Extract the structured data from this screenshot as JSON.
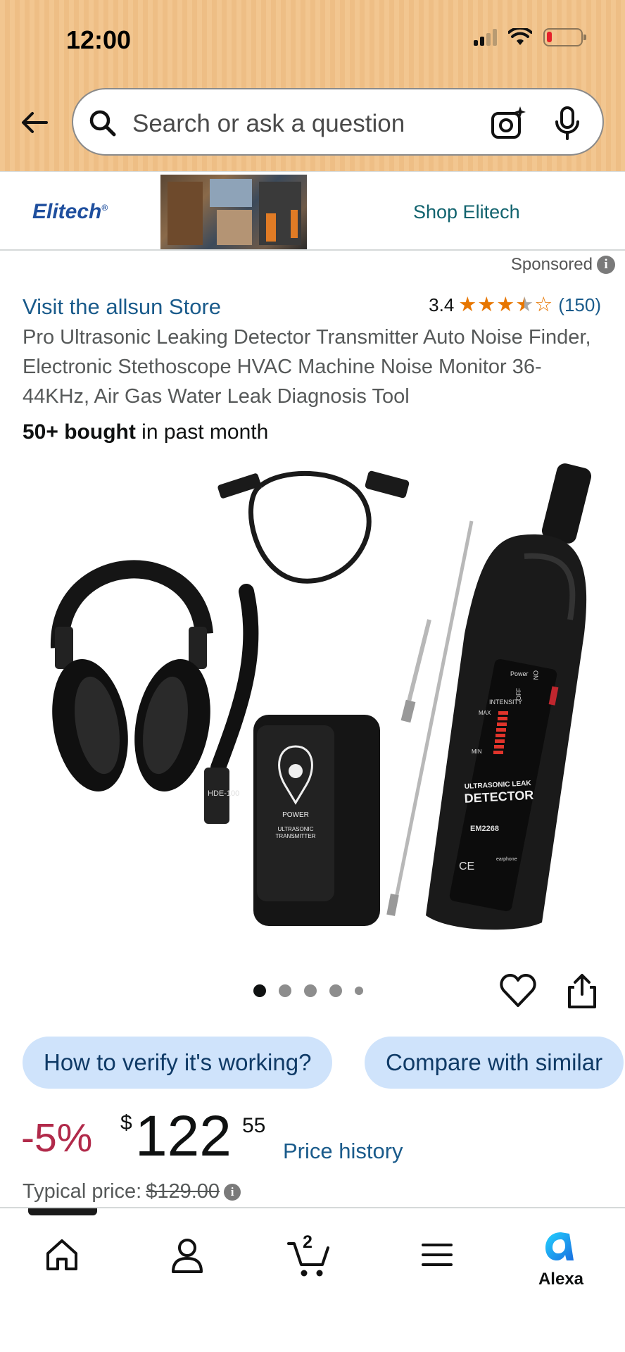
{
  "status_bar": {
    "time": "12:00"
  },
  "search": {
    "placeholder": "Search or ask a question"
  },
  "ad": {
    "brand": "Elitech",
    "brand_mark": "®",
    "link_text": "Shop Elitech",
    "sponsored_label": "Sponsored",
    "info_glyph": "i"
  },
  "product": {
    "store_link": "Visit the allsun Store",
    "rating_value": "3.4",
    "rating_stars": 3.5,
    "rating_count": "(150)",
    "title": "Pro Ultrasonic Leaking Detector Transmitter Auto Noise Finder, Electronic Stethoscope HVAC Machine Noise Monitor 36-44KHz, Air Gas Water Leak Diagnosis Tool",
    "bought_bold": "50+ bought",
    "bought_rest": " in past month",
    "image_labels": {
      "power": "Power",
      "on": "ON",
      "off": "OFF",
      "intensity": "INTENSITY",
      "max": "MAX",
      "min": "MIN",
      "detector_line1": "ULTRASONIC LEAK",
      "detector_line2": "DETECTOR",
      "model": "EM2268",
      "ce": "CE",
      "earphone": "earphone",
      "transmitter_power": "POWER",
      "transmitter_line1": "ULTRASONIC",
      "transmitter_line2": "TRANSMITTER",
      "tube_label": "HDE-100"
    },
    "image_carousel": {
      "total": 5,
      "active_index": 0
    }
  },
  "chips": [
    {
      "label": "How to verify it's working?"
    },
    {
      "label": "Compare with similar"
    }
  ],
  "price": {
    "discount": "-5%",
    "currency": "$",
    "whole": "122",
    "fraction": "55",
    "history_link": "Price history",
    "typical_label": "Typical price: ",
    "typical_value": "$129.00"
  },
  "bottom_nav": {
    "items": [
      {
        "label": "home",
        "icon": "home-icon"
      },
      {
        "label": "account",
        "icon": "person-icon"
      },
      {
        "label": "cart",
        "icon": "cart-icon",
        "count": "2"
      },
      {
        "label": "menu",
        "icon": "menu-icon"
      },
      {
        "label": "Alexa",
        "icon": "alexa-icon"
      }
    ]
  },
  "colors": {
    "header_bg": "#f2c690",
    "link": "#1a5b8b",
    "discount": "#b12a4a",
    "chip_bg": "#cfe3fb",
    "star": "#e77600"
  }
}
